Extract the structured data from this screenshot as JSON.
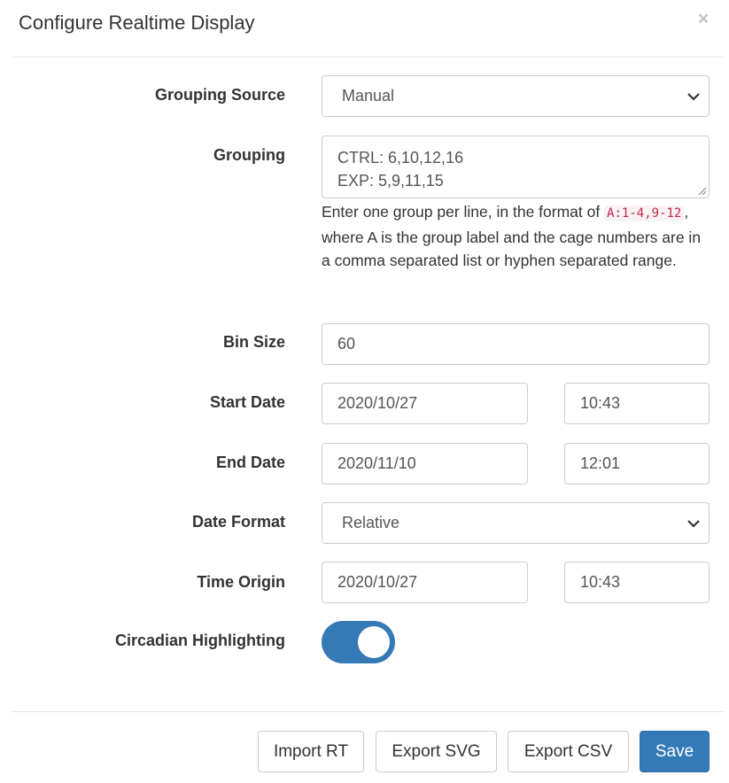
{
  "modal": {
    "title": "Configure Realtime Display",
    "close_label": "×"
  },
  "form": {
    "grouping_source": {
      "label": "Grouping Source",
      "value": "Manual"
    },
    "grouping": {
      "label": "Grouping",
      "lines": [
        "CTRL: 6,10,12,16",
        "EXP: 5,9,11,15"
      ],
      "help_prefix": "Enter one group per line, in the format of ",
      "help_code": "A:1-4,9-12",
      "help_suffix": ", where A is the group label and the cage numbers are in a comma separated list or hyphen separated range."
    },
    "bin_size": {
      "label": "Bin Size",
      "value": "60"
    },
    "start_date": {
      "label": "Start Date",
      "date": "2020/10/27",
      "time": "10:43"
    },
    "end_date": {
      "label": "End Date",
      "date": "2020/11/10",
      "time": "12:01"
    },
    "date_format": {
      "label": "Date Format",
      "value": "Relative"
    },
    "time_origin": {
      "label": "Time Origin",
      "date": "2020/10/27",
      "time": "10:43"
    },
    "circadian_highlighting": {
      "label": "Circadian Highlighting",
      "enabled": true
    }
  },
  "footer": {
    "import_rt": "Import RT",
    "export_svg": "Export SVG",
    "export_csv": "Export CSV",
    "save": "Save"
  },
  "colors": {
    "primary": "#337ab7",
    "code_text": "#c7254e",
    "code_bg": "#f9f2f4"
  }
}
